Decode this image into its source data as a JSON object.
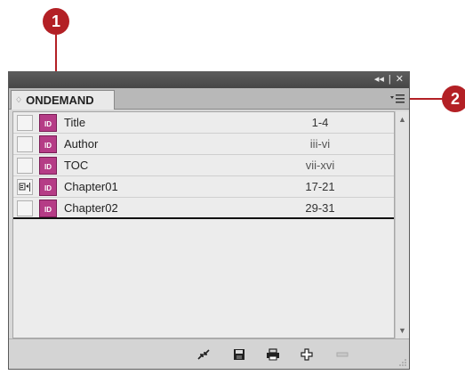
{
  "callouts": {
    "one": "1",
    "two": "2"
  },
  "panel": {
    "tab_label": "ONDEMAND",
    "tab_arrows": "♢",
    "window_controls": {
      "collapse": "◂◂",
      "separator": "|",
      "close": "✕"
    },
    "menu_icon": "panel-menu-icon"
  },
  "documents": [
    {
      "name": "Title",
      "pages": "1-4",
      "status": "none"
    },
    {
      "name": "Author",
      "pages": "iii-vi",
      "status": "none"
    },
    {
      "name": "TOC",
      "pages": "vii-xvi",
      "status": "none"
    },
    {
      "name": "Chapter01",
      "pages": "17-21",
      "status": "style-source"
    },
    {
      "name": "Chapter02",
      "pages": "29-31",
      "status": "none"
    }
  ],
  "doc_icon_label": "ID",
  "colors": {
    "callout": "#b32025",
    "doc_icon": "#b53c86",
    "titlebar": "#4f4f4f"
  }
}
